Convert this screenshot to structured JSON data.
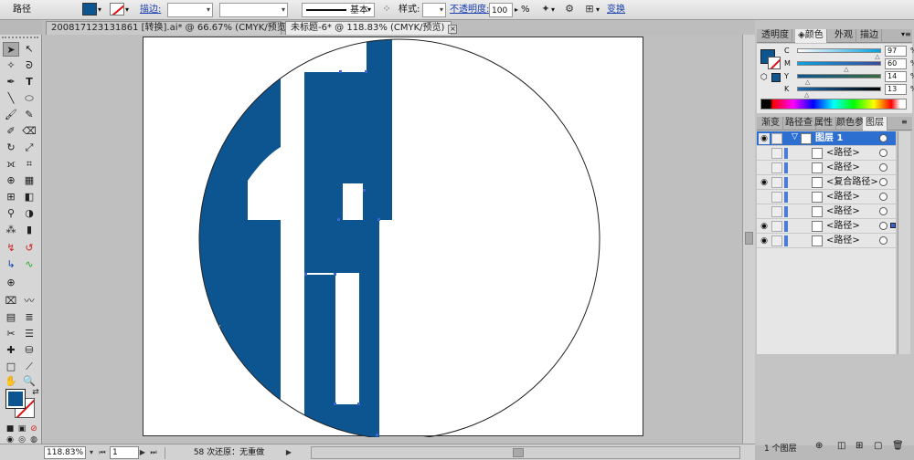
{
  "colors": {
    "fill": "#0d5590",
    "art": "#0d5590",
    "selection": "#3c64d0",
    "layer_highlight": "#2d6fd0"
  },
  "control_bar": {
    "object_type": "路径",
    "stroke_link": "描边:",
    "brush_profile": "基本",
    "style_label": "样式:",
    "opacity_link": "不透明度:",
    "opacity_value": "100",
    "opacity_unit": "%",
    "transform_link": "变换"
  },
  "tabs": [
    {
      "label": "20081712313186​1 [转换].ai* @ 66.67% (CMYK/预览)",
      "active": false
    },
    {
      "label": "未标题-6* @ 118.83% (CMYK/预览)",
      "active": true
    }
  ],
  "color_panel": {
    "tabs": [
      "透明度",
      "颜色",
      "外观",
      "描边"
    ],
    "active_tab": "颜色",
    "channels": [
      {
        "label": "C",
        "value": "97",
        "unit": "%",
        "level": 0.97
      },
      {
        "label": "M",
        "value": "60",
        "unit": "%",
        "level": 0.6
      },
      {
        "label": "Y",
        "value": "14",
        "unit": "%",
        "level": 0.14
      },
      {
        "label": "K",
        "value": "13",
        "unit": "%",
        "level": 0.13
      }
    ]
  },
  "layers_panel": {
    "tabs": [
      "渐变",
      "路径查",
      "属性",
      "颜色参",
      "图层"
    ],
    "active_tab": "图层",
    "layer_name": "图层 1",
    "items": [
      {
        "name": "<路径>",
        "visible": false,
        "selected": false
      },
      {
        "name": "<路径>",
        "visible": false,
        "selected": false
      },
      {
        "name": "<复合路径>",
        "visible": true,
        "selected": false
      },
      {
        "name": "<路径>",
        "visible": false,
        "selected": false
      },
      {
        "name": "<路径>",
        "visible": false,
        "selected": false
      },
      {
        "name": "<路径>",
        "visible": true,
        "selected": true
      },
      {
        "name": "<路径>",
        "visible": true,
        "selected": false
      }
    ],
    "footer_count": "1 个图层"
  },
  "status_bar": {
    "zoom": "118.83%",
    "artboard_number": "1",
    "status_text": "58 次还原：无重做"
  }
}
